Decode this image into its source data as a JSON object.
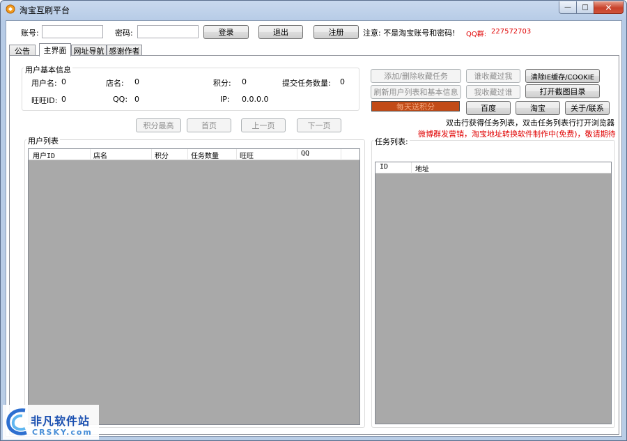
{
  "window": {
    "title": "淘宝互刷平台",
    "controls": {
      "minimize": "—",
      "maximize": "□",
      "close": "✕"
    }
  },
  "login": {
    "account_label": "账号:",
    "account_value": "",
    "password_label": "密码:",
    "password_value": "",
    "login_button": "登录",
    "logout_button": "退出",
    "register_button": "注册",
    "notice": "注意: 不是淘宝账号和密码!",
    "qq_group_label": "QQ群:",
    "qq_group_value": "227572703"
  },
  "tabs": [
    {
      "label": "公告",
      "active": false
    },
    {
      "label": "主界面",
      "active": true
    },
    {
      "label": "网址导航",
      "active": false
    },
    {
      "label": "感谢作者",
      "active": false
    }
  ],
  "user_info": {
    "group_title": "用户基本信息",
    "username_label": "用户名:",
    "username_value": "0",
    "shop_label": "店名:",
    "shop_value": "0",
    "points_label": "积分:",
    "points_value": "0",
    "submitted_label": "提交任务数量:",
    "submitted_value": "0",
    "wangwang_label": "旺旺ID:",
    "wangwang_value": "0",
    "qq_label": "QQ:",
    "qq_value": "0",
    "ip_label": "IP:",
    "ip_value": "0.0.0.0"
  },
  "actions": {
    "add_remove_fav": "添加/删除收藏任务",
    "who_collected_me": "谁收藏过我",
    "clear_ie_cache": "清除IE缓存/COOKIE",
    "refresh_users": "刷新用户列表和基本信息",
    "i_collected_who": "我收藏过谁",
    "open_screenshot_dir": "打开截图目录",
    "daily_points": "每天送积分",
    "baidu": "百度",
    "taobao": "淘宝",
    "about": "关于/联系"
  },
  "hints": {
    "double_click": "双击行获得任务列表，双击任务列表行打开浏览器",
    "promo": "微博群发营销，淘宝地址转换软件制作中(免费)，敬请期待"
  },
  "paging": {
    "top_points": "积分最高",
    "first_page": "首页",
    "prev_page": "上一页",
    "next_page": "下一页"
  },
  "user_list": {
    "title": "用户列表",
    "columns": [
      "用户ID",
      "店名",
      "积分",
      "任务数量",
      "旺旺",
      "QQ"
    ],
    "rows": []
  },
  "task_list": {
    "title": "任务列表:",
    "columns": [
      "ID",
      "地址"
    ],
    "rows": []
  },
  "watermark": {
    "brand": "非凡软件站",
    "domain": "CRSKY.com"
  },
  "colors": {
    "score_bar_bg": "#c24b17",
    "score_bar_text": "#f3a77d",
    "qq_group_text": "#e00000",
    "promo_text": "#e00000",
    "list_bg": "#a9a9a9"
  }
}
